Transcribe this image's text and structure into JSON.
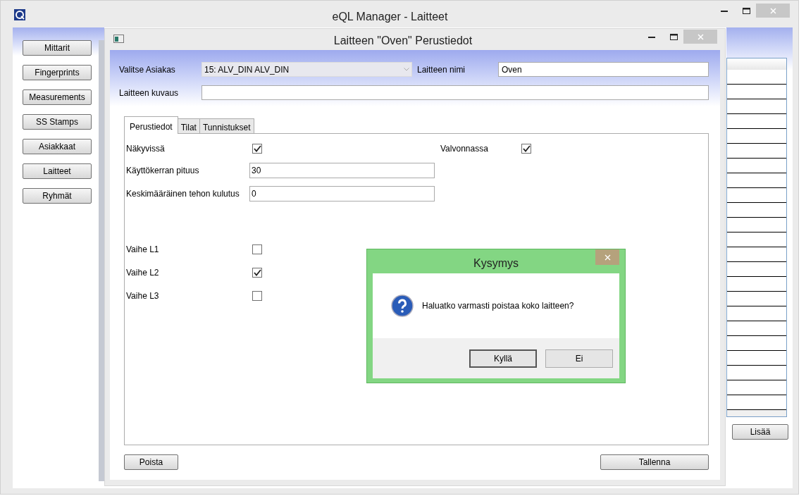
{
  "window": {
    "title": "eQL Manager - Laitteet"
  },
  "sidebar": {
    "buttons": [
      "Mittarit",
      "Fingerprints",
      "Measurements",
      "SS Stamps",
      "Asiakkaat",
      "Laitteet",
      "Ryhmät"
    ]
  },
  "device_list": {
    "add_button": "Lisää"
  },
  "device_window": {
    "title": "Laitteen \"Oven\" Perustiedot",
    "customer": {
      "label": "Valitse Asiakas",
      "value": "15: ALV_DIN ALV_DIN"
    },
    "name": {
      "label": "Laitteen nimi",
      "value": "Oven"
    },
    "description": {
      "label": "Laitteen kuvaus"
    },
    "tabs": [
      {
        "label": "Perustiedot",
        "selected": true
      },
      {
        "label": "Tilat",
        "selected": false
      },
      {
        "label": "Tunnistukset",
        "selected": false
      }
    ],
    "visible": {
      "label": "Näkyvissä",
      "checked": true
    },
    "monitored": {
      "label": "Valvonnassa",
      "checked": true
    },
    "inputs": [
      {
        "label": "Käyttökerran pituus",
        "value": "30"
      },
      {
        "label": "Keskimääräinen tehon kulutus",
        "value": "0"
      }
    ],
    "phases": [
      {
        "label": "Vaihe L1",
        "checked": false
      },
      {
        "label": "Vaihe L2",
        "checked": true
      },
      {
        "label": "Vaihe L3",
        "checked": false
      }
    ],
    "delete_button": "Poista",
    "save_button": "Tallenna"
  },
  "dialog": {
    "title": "Kysymys",
    "message": "Haluatko varmasti poistaa koko laitteen?",
    "buttons": [
      "Kyllä",
      "Ei"
    ]
  }
}
